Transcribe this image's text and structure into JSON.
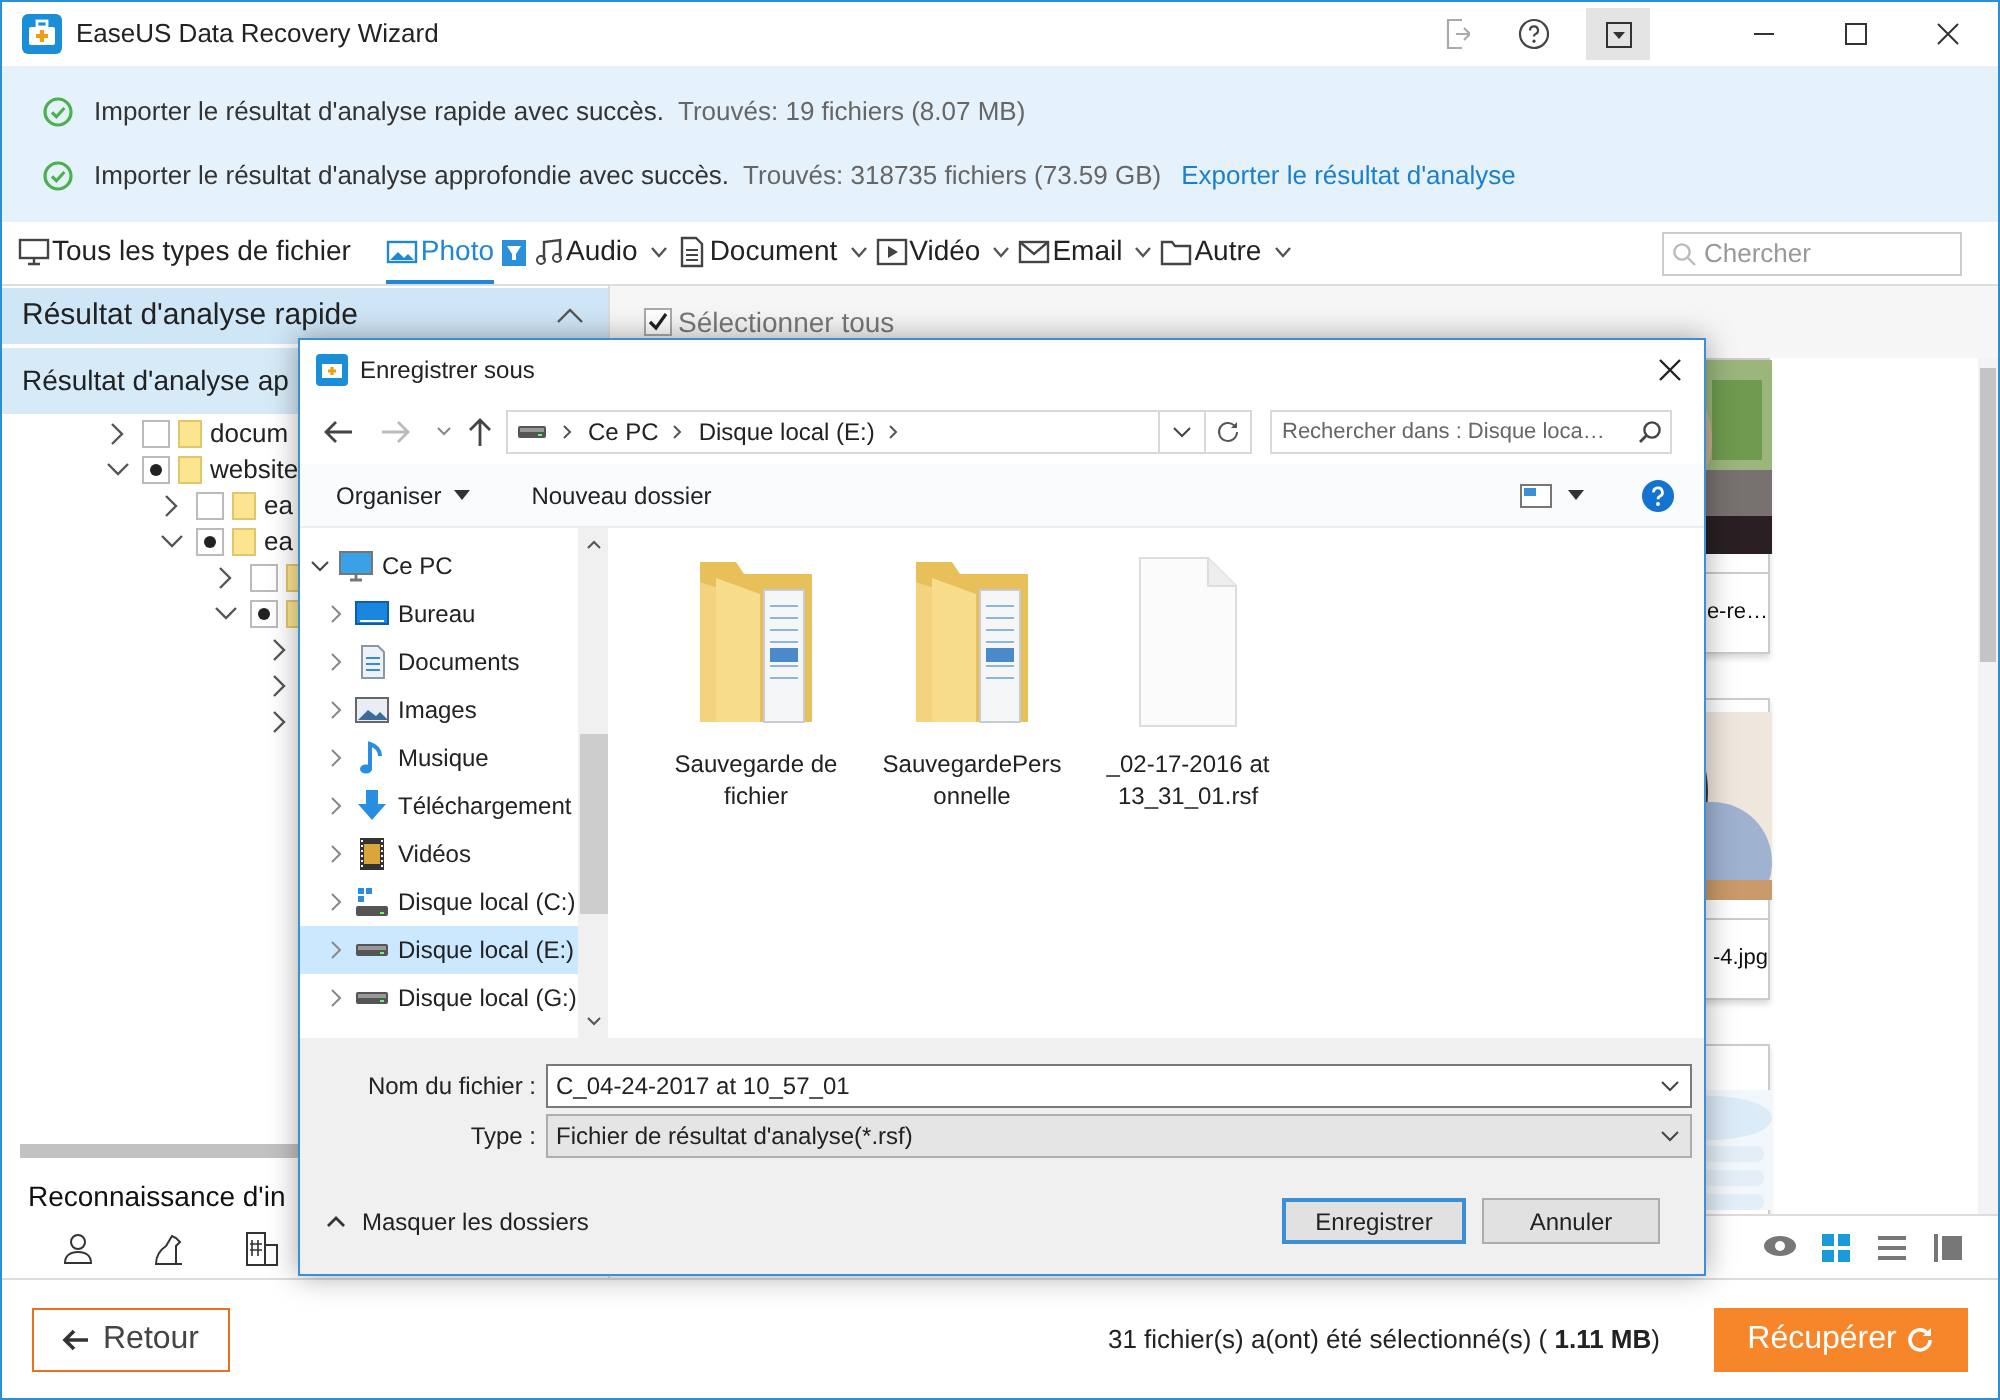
{
  "window": {
    "title": "EaseUS Data Recovery Wizard"
  },
  "notifications": [
    {
      "message": "Importer le résultat d'analyse rapide avec succès.",
      "found": "Trouvés: 19 fichiers (8.07 MB)"
    },
    {
      "message": "Importer le résultat d'analyse approfondie avec succès.",
      "found": "Trouvés: 318735 fichiers (73.59 GB)",
      "link": "Exporter le résultat d'analyse"
    }
  ],
  "file_types": [
    {
      "label": "Tous les types de fichier",
      "kind": "all",
      "selected": false,
      "dropdown": false
    },
    {
      "label": "Photo",
      "selected": true,
      "dropdown": false,
      "filter": true
    },
    {
      "label": "Audio",
      "kind": "audio",
      "selected": false,
      "dropdown": true
    },
    {
      "label": "Document",
      "kind": "document",
      "selected": false,
      "dropdown": true
    },
    {
      "label": "Vidéo",
      "kind": "video",
      "selected": false,
      "dropdown": true
    },
    {
      "label": "Email",
      "kind": "email",
      "selected": false,
      "dropdown": true
    },
    {
      "label": "Autre",
      "kind": "other",
      "selected": false,
      "dropdown": true
    }
  ],
  "search": {
    "placeholder": "Chercher"
  },
  "sidebar": {
    "sections": [
      {
        "label": "Résultat d'analyse rapide"
      },
      {
        "label": "Résultat d'analyse ap"
      }
    ],
    "tree": [
      {
        "label": "docum",
        "expanded": false,
        "partial": false
      },
      {
        "label": "website",
        "expanded": true,
        "partial": true,
        "children": [
          {
            "label": "ea",
            "expanded": false,
            "partial": false
          },
          {
            "label": "ea",
            "expanded": true,
            "partial": true,
            "children": [
              {
                "expanded": false,
                "partial": false
              },
              {
                "expanded": true,
                "partial": true,
                "children": [
                  {
                    "expanded": false
                  },
                  {
                    "expanded": false
                  },
                  {
                    "expanded": false
                  }
                ]
              }
            ]
          }
        ]
      }
    ],
    "recognition": "Reconnaissance d'in"
  },
  "select_all": {
    "label": "Sélectionner tous",
    "checked": true
  },
  "thumbnails": [
    {
      "kind": "picture",
      "caption": "e-re…"
    },
    {
      "kind": "picture",
      "caption": "-4.jpg"
    },
    {
      "kind": "picture"
    }
  ],
  "views": [
    {
      "kind": "preview",
      "selected": false
    },
    {
      "kind": "grid",
      "selected": true
    },
    {
      "kind": "list",
      "selected": false
    },
    {
      "kind": "detail",
      "selected": false
    }
  ],
  "back_button": "Retour",
  "status": "31 fichier(s) a(ont) été sélectionné(s) ( **1.11 MB**)",
  "recover_button": "Récupérer",
  "dialog": {
    "title": "Enregistrer sous",
    "address": [
      "Ce PC",
      "Disque local (E:)"
    ],
    "search_placeholder": "Rechercher dans : Disque loca…",
    "toolbar": [
      "Organiser",
      "Nouveau dossier"
    ],
    "nav": [
      {
        "label": "Ce PC",
        "kind": "pc",
        "expanded": true,
        "selected": false,
        "children": [
          {
            "label": "Bureau",
            "kind": "desktop",
            "expanded": false,
            "selected": false
          },
          {
            "label": "Documents",
            "kind": "documents",
            "expanded": false,
            "selected": false
          },
          {
            "label": "Images",
            "kind": "images",
            "expanded": false,
            "selected": false
          },
          {
            "label": "Musique",
            "kind": "music",
            "expanded": false,
            "selected": false
          },
          {
            "label": "Téléchargement",
            "kind": "downloads",
            "expanded": false,
            "selected": false
          },
          {
            "label": "Vidéos",
            "kind": "videos",
            "expanded": false,
            "selected": false
          },
          {
            "label": "Disque local (C:)",
            "kind": "system-drive",
            "expanded": false,
            "selected": false
          },
          {
            "label": "Disque local (E:)",
            "kind": "drive",
            "expanded": false,
            "selected": true
          },
          {
            "label": "Disque local (G:)",
            "kind": "drive",
            "expanded": false,
            "selected": false
          }
        ]
      }
    ],
    "files": [
      {
        "name": "Sauvegarde de fichier",
        "kind": "folder"
      },
      {
        "name": "SauvegardePersonnelle",
        "kind": "folder"
      },
      {
        "name": "_02-17-2016 at 13_31_01.rsf",
        "kind": "file"
      }
    ],
    "filename_label": "Nom du fichier :",
    "filename": "C_04-24-2017 at 10_57_01",
    "type_label": "Type :",
    "type": "Fichier de résultat d'analyse(*.rsf)",
    "hide_folders": "Masquer les dossiers",
    "save": "Enregistrer",
    "cancel": "Annuler"
  }
}
